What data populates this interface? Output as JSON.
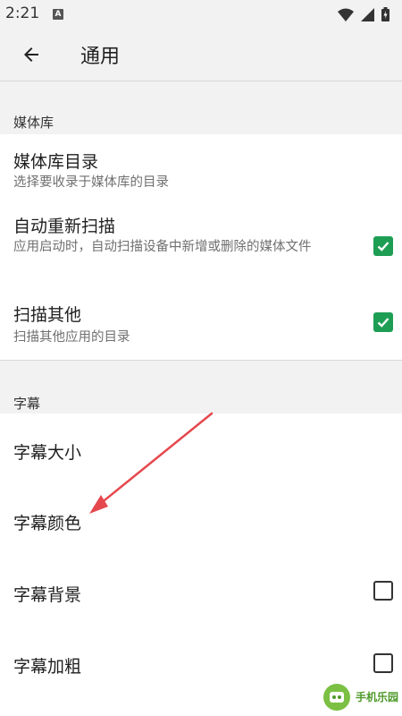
{
  "status_bar": {
    "time": "2:21",
    "notification_letter": "A"
  },
  "toolbar": {
    "title": "通用",
    "back_icon": "arrow-left-icon"
  },
  "sections": {
    "media": {
      "header": "媒体库",
      "items": [
        {
          "title": "媒体库目录",
          "summary": "选择要收录于媒体库的目录"
        },
        {
          "title": "自动重新扫描",
          "summary": "应用启动时，自动扫描设备中新增或删除的媒体文件",
          "checked": true
        },
        {
          "title": "扫描其他",
          "summary": "扫描其他应用的目录",
          "checked": true
        }
      ]
    },
    "subtitles": {
      "header": "字幕",
      "items": [
        {
          "title": "字幕大小"
        },
        {
          "title": "字幕颜色"
        },
        {
          "title": "字幕背景",
          "checked": false
        },
        {
          "title": "字幕加粗",
          "checked": false
        }
      ]
    }
  },
  "accent_color": "#1e9e55",
  "annotation_arrow_color": "#e5484d",
  "watermark": {
    "text": "手机乐园"
  }
}
